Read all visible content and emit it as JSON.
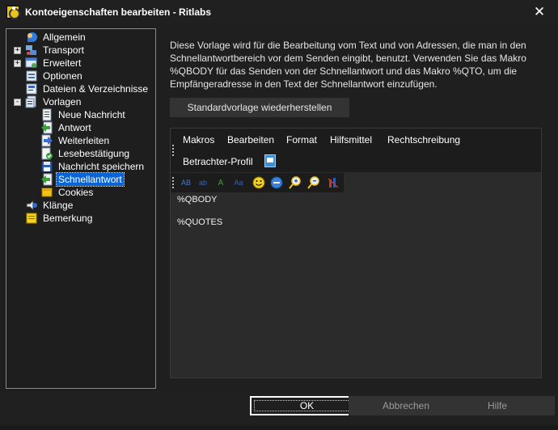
{
  "window": {
    "title": "Kontoeigenschaften bearbeiten - Ritlabs",
    "close_glyph": "✕"
  },
  "tree": {
    "items": [
      {
        "label": "Allgemein",
        "icon": "globe-user-icon",
        "expander": ""
      },
      {
        "label": "Transport",
        "icon": "network-icon",
        "expander": "+"
      },
      {
        "label": "Erweitert",
        "icon": "window-icon",
        "expander": "+"
      },
      {
        "label": "Optionen",
        "icon": "options-icon",
        "expander": ""
      },
      {
        "label": "Dateien & Verzeichnisse",
        "icon": "files-icon",
        "expander": ""
      },
      {
        "label": "Vorlagen",
        "icon": "templates-icon",
        "expander": "-"
      },
      {
        "label": "Neue Nachricht",
        "icon": "document-icon",
        "expander": ""
      },
      {
        "label": "Antwort",
        "icon": "reply-icon",
        "expander": ""
      },
      {
        "label": "Weiterleiten",
        "icon": "forward-icon",
        "expander": ""
      },
      {
        "label": "Lesebestätigung",
        "icon": "read-receipt-icon",
        "expander": ""
      },
      {
        "label": "Nachricht speichern",
        "icon": "save-message-icon",
        "expander": ""
      },
      {
        "label": "Schnellantwort",
        "icon": "quick-reply-icon",
        "expander": "",
        "selected": true
      },
      {
        "label": "Cookies",
        "icon": "cookies-icon",
        "expander": ""
      },
      {
        "label": "Klänge",
        "icon": "speaker-icon",
        "expander": ""
      },
      {
        "label": "Bemerkung",
        "icon": "note-icon",
        "expander": ""
      }
    ]
  },
  "description": "Diese Vorlage wird für die Bearbeitung vom Text und von Adressen, die man in den Schnellantwortbereich vor dem Senden eingibt, benutzt. Verwenden Sie das Makro %QBODY für das Senden von der Schnellantwort und das Makro %QTO, um die Empfängeradresse in den Text der Schnellantwort einzufügen.",
  "restore_button": "Standardvorlage wiederherstellen",
  "editor": {
    "menus": [
      "Makros",
      "Bearbeiten",
      "Format",
      "Hilfsmittel",
      "Rechtschreibung"
    ],
    "viewer_profile_label": "Betrachter-Profil",
    "toolbar_icons": [
      "font-ab-icon",
      "font-color-icon",
      "text-style-icon",
      "font-size-icon",
      "smiley-icon",
      "insert-icon",
      "zoom-in-icon",
      "zoom-out-icon",
      "spell-icon"
    ],
    "lines": [
      "%QBODY",
      "%QUOTES"
    ]
  },
  "footer": {
    "ok": "OK",
    "cancel": "Abbrechen",
    "help": "Hilfe"
  },
  "colors": {
    "background": "#1f1f1f",
    "selection": "#0a64d6",
    "editor_bg": "#2b2b2b"
  }
}
